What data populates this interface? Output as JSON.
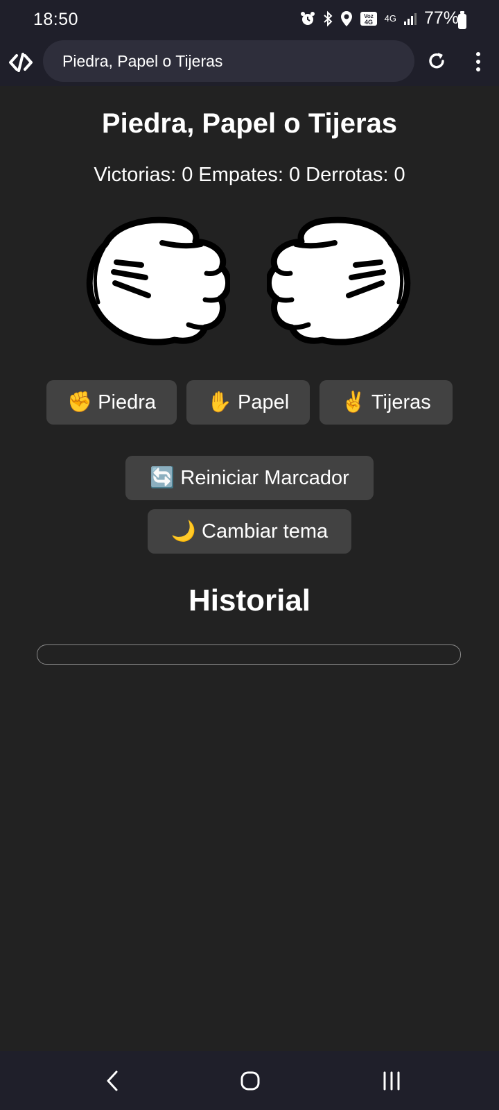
{
  "status_bar": {
    "time": "18:50",
    "network_label": "4G",
    "battery": "77%"
  },
  "browser": {
    "url_text": "Piedra, Papel o Tijeras"
  },
  "game": {
    "title": "Piedra, Papel o Tijeras",
    "score_text": "Victorias: 0 Empates: 0 Derrotas: 0",
    "buttons": {
      "piedra": "✊ Piedra",
      "papel": "✋ Papel",
      "tijeras": "✌️ Tijeras",
      "reset": "🔄 Reiniciar Marcador",
      "theme": "🌙 Cambiar tema"
    },
    "history_title": "Historial"
  },
  "colors": {
    "background": "#222222",
    "button": "#424242",
    "bars": "#1f1f2a"
  }
}
